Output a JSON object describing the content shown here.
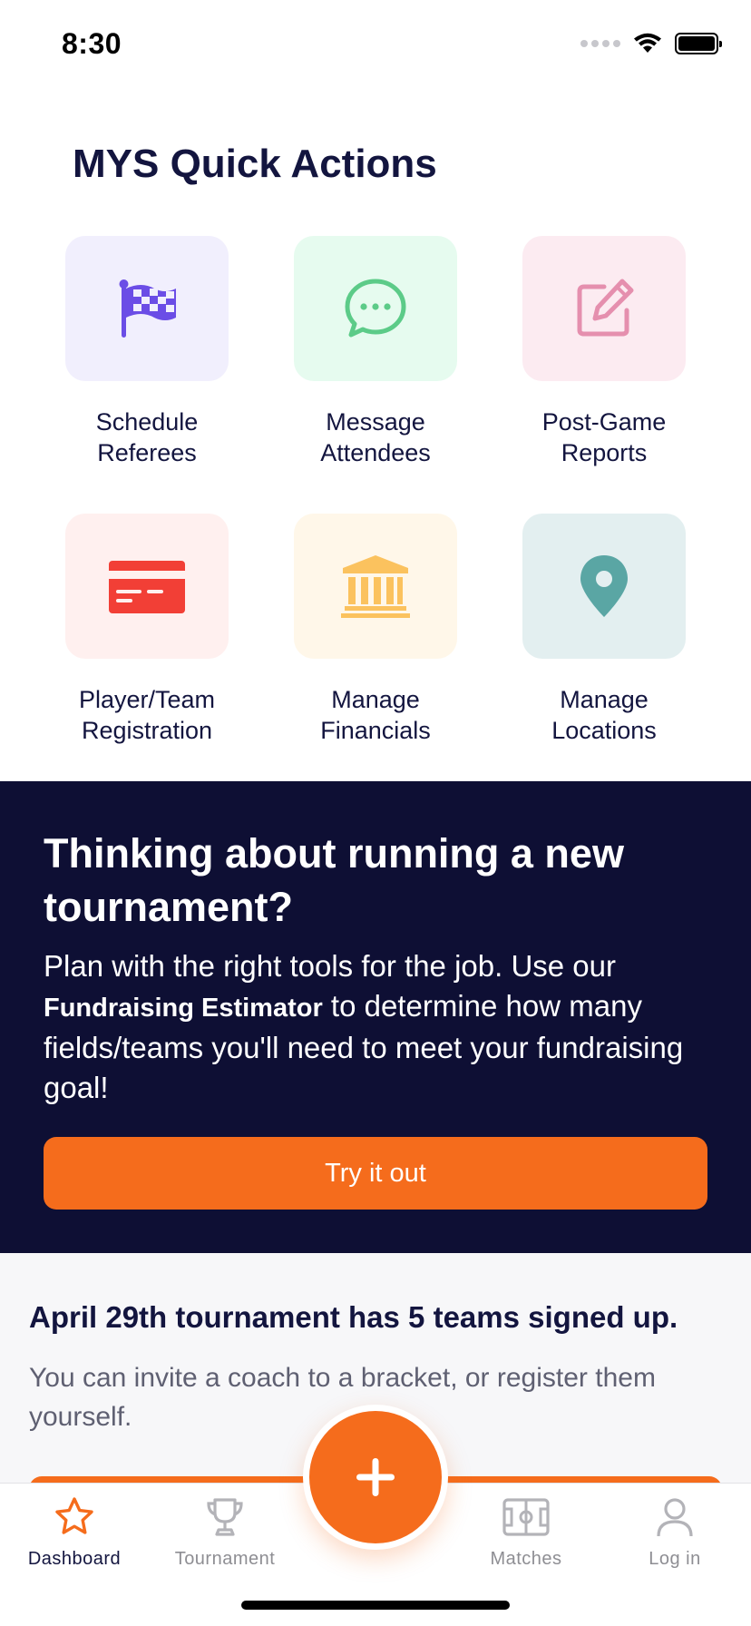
{
  "status_bar": {
    "time": "8:30"
  },
  "quick_actions": {
    "title": "MYS Quick Actions",
    "items": [
      {
        "line1": "Schedule",
        "line2": "Referees",
        "icon": "checkered-flag-icon",
        "tile_color": "#f1effd",
        "icon_color": "#6b4de6"
      },
      {
        "line1": "Message",
        "line2": "Attendees",
        "icon": "chat-bubble-icon",
        "tile_color": "#e6fbef",
        "icon_color": "#5ccb88"
      },
      {
        "line1": "Post-Game",
        "line2": "Reports",
        "icon": "edit-icon",
        "tile_color": "#fcebf1",
        "icon_color": "#e58fae"
      },
      {
        "line1": "Player/Team",
        "line2": "Registration",
        "icon": "credit-card-icon",
        "tile_color": "#fff0ef",
        "icon_color": "#f23f36"
      },
      {
        "line1": "Manage",
        "line2": "Financials",
        "icon": "bank-icon",
        "tile_color": "#fff7e9",
        "icon_color": "#fbc25e"
      },
      {
        "line1": "Manage",
        "line2": "Locations",
        "icon": "map-pin-icon",
        "tile_color": "#e3eff0",
        "icon_color": "#5aa6a4"
      }
    ]
  },
  "promo": {
    "title": "Thinking about running a new tournament?",
    "body_before": "Plan with the right tools for the job. Use our ",
    "body_bold": "Fundraising Estimator",
    "body_after": "  to determine how many fields/teams you'll need to meet your fundraising goal!",
    "button_label": "Try it out",
    "background": "#0e0f34",
    "accent": "#f56c1c"
  },
  "info_card": {
    "title": "April 29th tournament has 5 teams signed up.",
    "body": "You can invite a coach to a bracket, or register them yourself."
  },
  "tab_bar": {
    "tabs": [
      {
        "label": "Dashboard",
        "icon": "star-icon",
        "active": true
      },
      {
        "label": "Tournament",
        "icon": "trophy-icon",
        "active": false
      },
      {
        "label": "Matches",
        "icon": "field-icon",
        "active": false
      },
      {
        "label": "Log in",
        "icon": "user-icon",
        "active": false
      }
    ],
    "fab_icon": "plus-icon"
  }
}
